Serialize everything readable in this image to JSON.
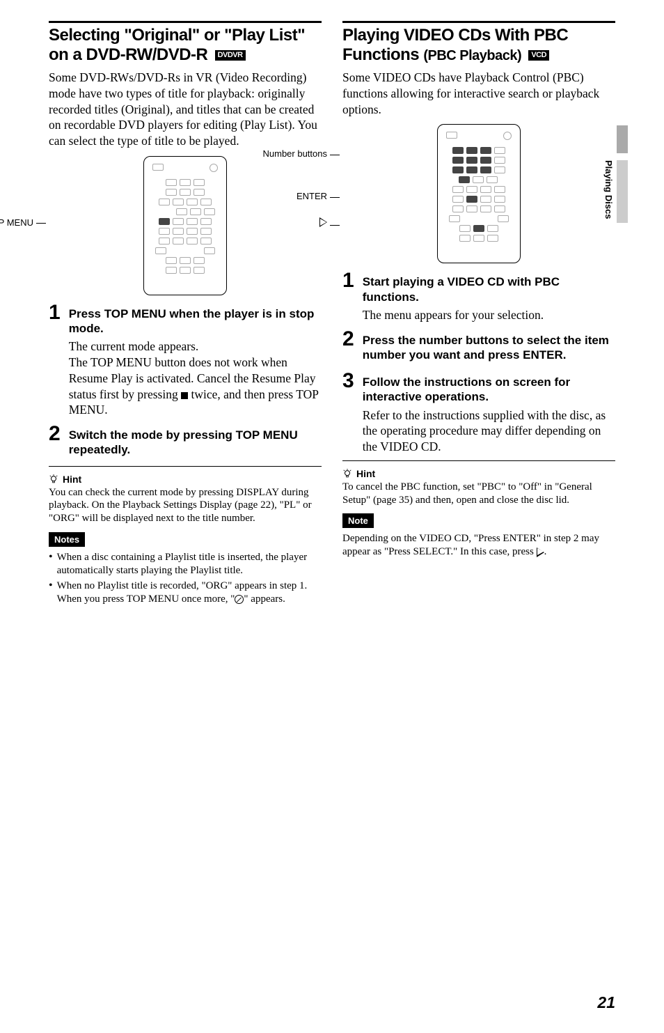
{
  "sideTab": "Playing Discs",
  "pageNumber": "21",
  "left": {
    "title": "Selecting \"Original\" or \"Play List\" on a DVD-RW/DVD-R",
    "titleBadge": "DVDVR",
    "intro": "Some DVD-RWs/DVD-Rs in VR (Video Recording) mode have two types of title for playback: originally recorded titles (Original), and titles that can be created on recordable DVD players for editing (Play List). You can select the type of title to be played.",
    "remoteLabel": "TOP MENU",
    "step1Head": "Press TOP MENU when the player is in stop mode.",
    "step1TextA": "The current mode appears.",
    "step1TextB_before": "The TOP MENU button does not work when Resume Play is activated. Cancel the Resume Play status first by pressing ",
    "step1TextB_after": " twice, and then press TOP MENU.",
    "step2Head": "Switch the mode by pressing TOP MENU repeatedly.",
    "hintLabel": "Hint",
    "hintText": "You can check the current mode by pressing DISPLAY during playback. On the Playback Settings Display (page 22), \"PL\" or \"ORG\" will be displayed next to the title number.",
    "notesLabel": "Notes",
    "note1": "When a disc containing a Playlist title is inserted, the player automatically starts playing the Playlist title.",
    "note2_before": "When no Playlist title is recorded, \"ORG\" appears in step 1. When you press TOP MENU once more, \"",
    "note2_after": "\" appears."
  },
  "right": {
    "title1": "Playing VIDEO CDs With PBC Functions ",
    "title2": "(PBC Playback)",
    "titleBadge": "VCD",
    "intro": "Some VIDEO CDs have Playback Control (PBC) functions allowing for interactive search or playback options.",
    "remoteLabel1": "Number buttons",
    "remoteLabel2": "ENTER",
    "step1Head": "Start playing a VIDEO CD with PBC functions.",
    "step1Text": "The menu appears for your selection.",
    "step2Head": "Press the number buttons to select the item number you want and press ENTER.",
    "step3Head": "Follow the instructions on screen for interactive operations.",
    "step3Text": "Refer to the instructions supplied with the disc, as the operating procedure may differ depending on the VIDEO CD.",
    "hintLabel": "Hint",
    "hintText": "To cancel the PBC function, set \"PBC\" to \"Off\" in \"General Setup\" (page 35) and then, open and close the disc lid.",
    "noteLabel": "Note",
    "noteText_before": "Depending on the VIDEO CD, \"Press ENTER\" in step 2 may appear as \"Press SELECT.\" In this case, press ",
    "noteText_after": "."
  }
}
